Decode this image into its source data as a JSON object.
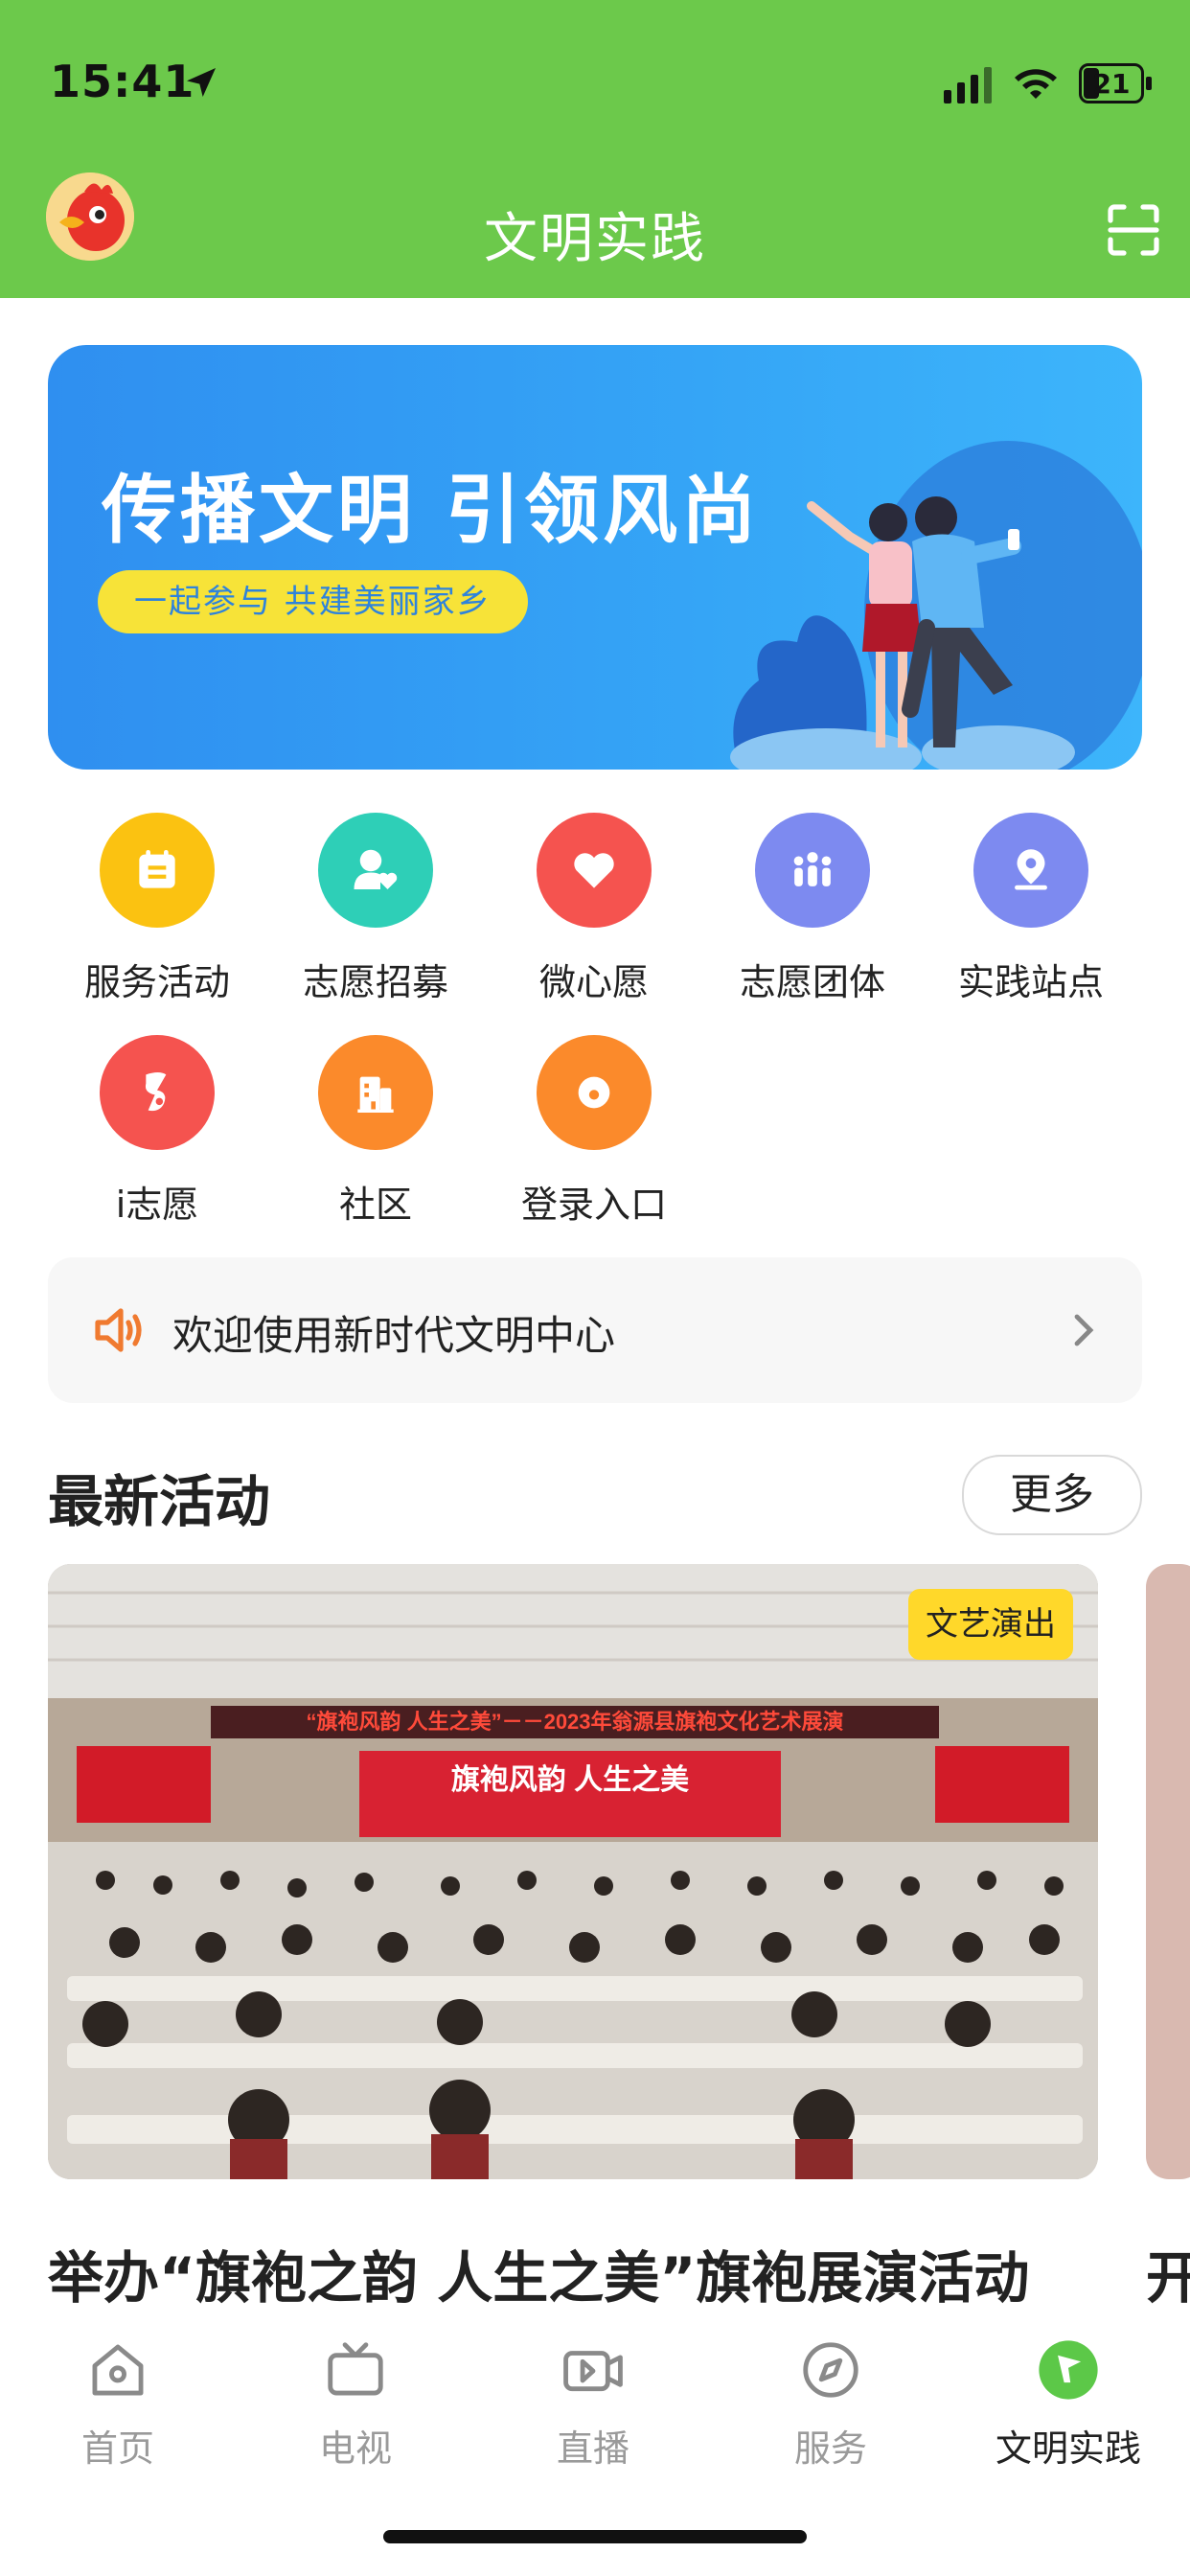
{
  "status_bar": {
    "time": "15:41",
    "battery": "21"
  },
  "header": {
    "title": "文明实践"
  },
  "banner": {
    "title": "传播文明 引领风尚",
    "subtitle": "一起参与 共建美丽家乡"
  },
  "quick_links": [
    {
      "label": "服务活动",
      "icon": "calendar-icon",
      "color": "#fbc211"
    },
    {
      "label": "志愿招募",
      "icon": "volunteer-heart-icon",
      "color": "#2ecfb7"
    },
    {
      "label": "微心愿",
      "icon": "heart-icon",
      "color": "#f5534f"
    },
    {
      "label": "志愿团体",
      "icon": "group-icon",
      "color": "#7d8af0"
    },
    {
      "label": "实践站点",
      "icon": "location-pin-icon",
      "color": "#7d8af0"
    },
    {
      "label": "i志愿",
      "icon": "i-volunteer-icon",
      "color": "#f5534f"
    },
    {
      "label": "社区",
      "icon": "building-icon",
      "color": "#fb8a2b"
    },
    {
      "label": "登录入口",
      "icon": "login-icon",
      "color": "#fb8a2b"
    }
  ],
  "notice": {
    "text": "欢迎使用新时代文明中心"
  },
  "latest": {
    "title": "最新活动",
    "more_label": "更多",
    "cards": [
      {
        "tag": "文艺演出",
        "caption": "举办“旗袍之韵 人生之美”旗袍展演活动"
      },
      {
        "caption": "开"
      }
    ],
    "photo_banner_text": "“旗袍风韵 人生之美”－－2023年翁源县旗袍文化艺术展演",
    "photo_screen_text": "旗袍风韵 人生之美"
  },
  "tabbar": [
    {
      "label": "首页",
      "icon": "home-icon",
      "active": false
    },
    {
      "label": "电视",
      "icon": "tv-icon",
      "active": false
    },
    {
      "label": "直播",
      "icon": "live-video-icon",
      "active": false
    },
    {
      "label": "服务",
      "icon": "compass-icon",
      "active": false
    },
    {
      "label": "文明实践",
      "icon": "flag-icon",
      "active": true
    }
  ],
  "colors": {
    "header_green": "#6cc94b",
    "banner_blue": "#2f8ff0",
    "tag_yellow": "#ffd82a",
    "active_green": "#5cc848"
  }
}
